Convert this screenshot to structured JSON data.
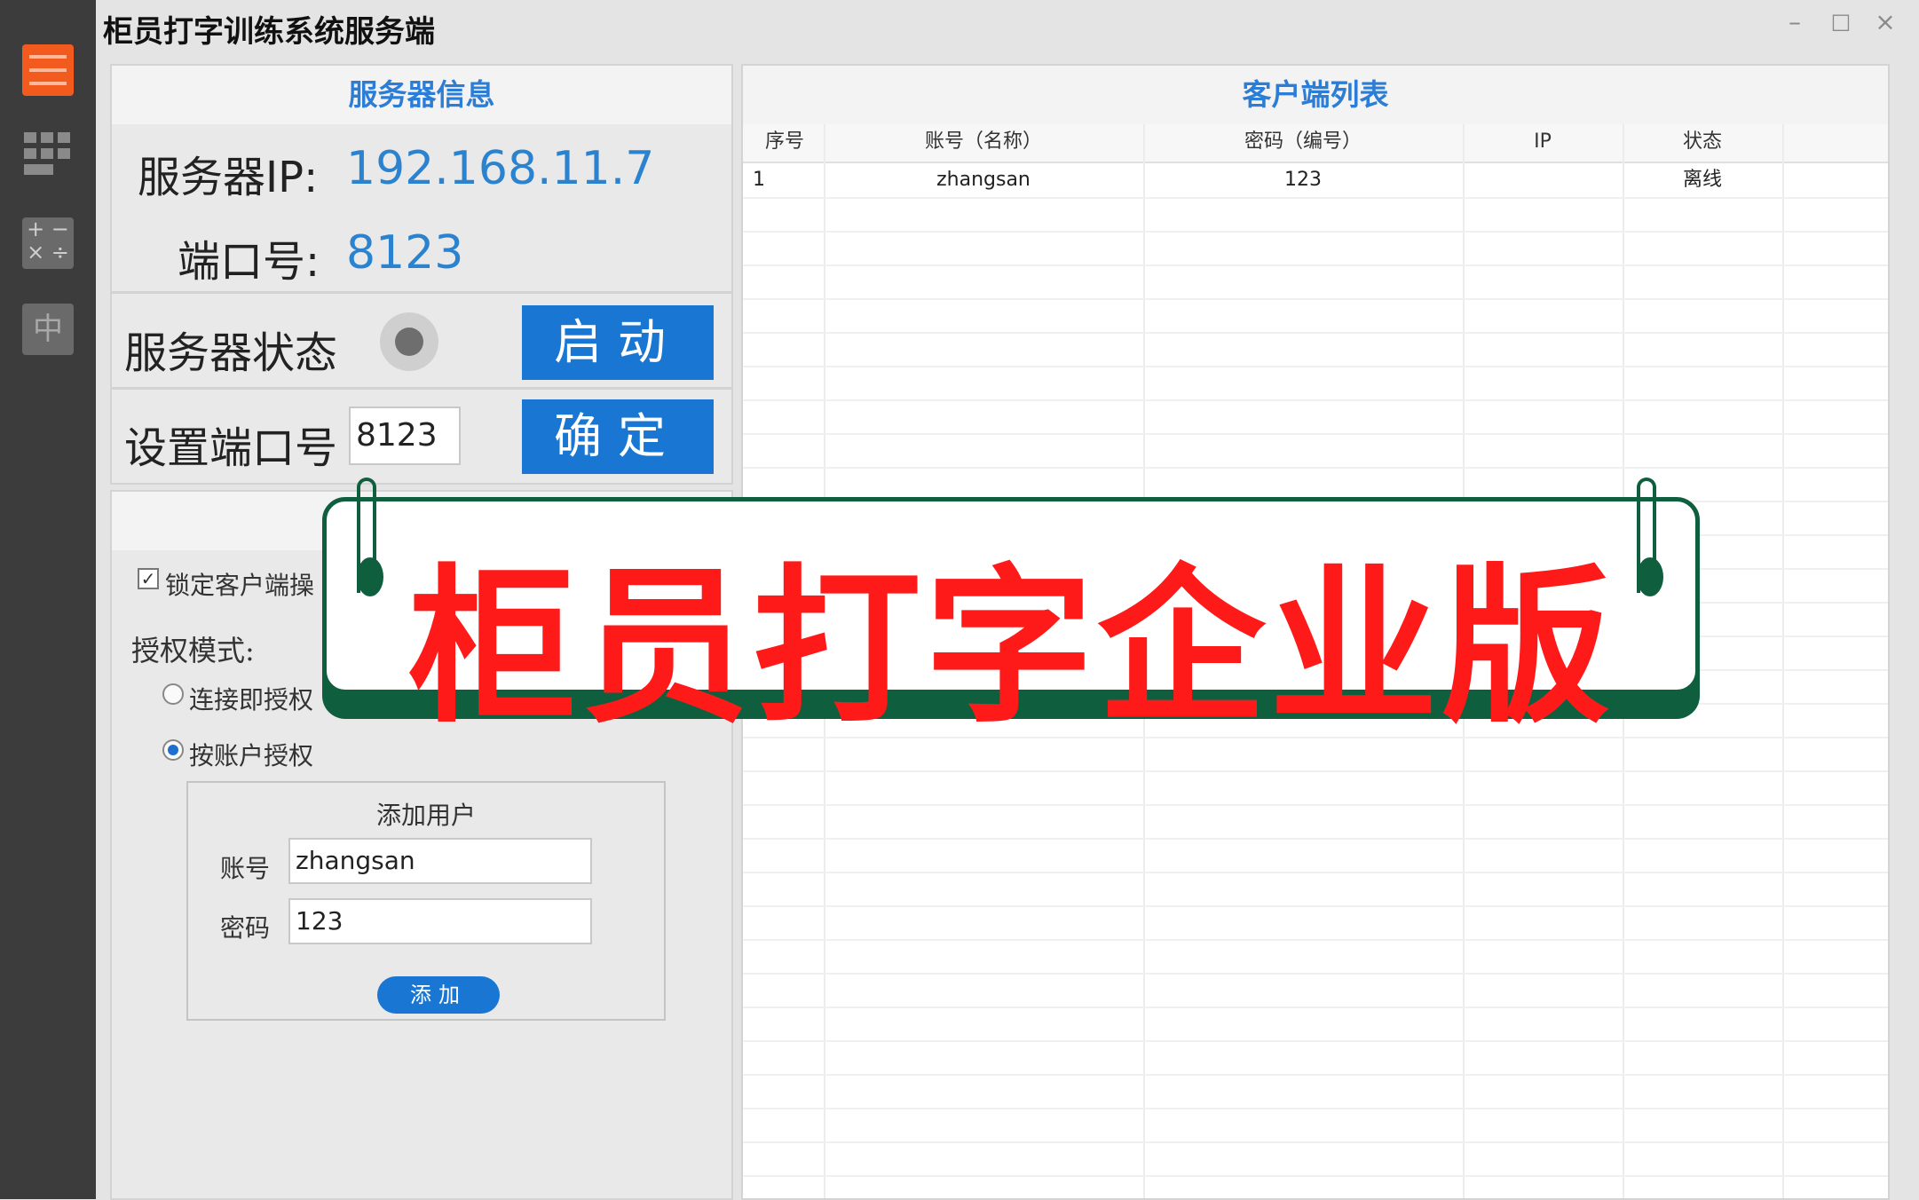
{
  "app": {
    "title": "柜员打字训练系统服务端"
  },
  "window_controls": {
    "minimize": "–",
    "maximize": "□",
    "close": "×"
  },
  "sidebar": {
    "icons": [
      "list-icon",
      "grid-icon",
      "calculator-icon",
      "chinese-input-icon"
    ],
    "cn_label": "中"
  },
  "server_info": {
    "header": "服务器信息",
    "ip_label": "服务器IP:",
    "ip_value": "192.168.11.7",
    "port_label": "端口号:",
    "port_value": "8123",
    "status_label": "服务器状态",
    "start_button": "启动",
    "set_port_label": "设置端口号",
    "set_port_value": "8123",
    "confirm_button": "确定"
  },
  "options": {
    "lock_client_label": "锁定客户端操",
    "lock_client_checked": true,
    "auth_mode_label": "授权模式:",
    "radio_connect": "连接即授权",
    "radio_account": "按账户授权",
    "selected_radio": "按账户授权"
  },
  "add_user": {
    "title": "添加用户",
    "account_label": "账号",
    "account_value": "zhangsan",
    "password_label": "密码",
    "password_value": "123",
    "add_button": "添加"
  },
  "client_list": {
    "header": "客户端列表",
    "columns": [
      "序号",
      "账号（名称）",
      "密码（编号）",
      "IP",
      "状态"
    ],
    "rows": [
      {
        "seq": "1",
        "account": "zhangsan",
        "password": "123",
        "ip": "",
        "status": "离线"
      }
    ]
  },
  "banner": {
    "text": "柜员打字企业版"
  },
  "colors": {
    "accent_blue": "#1976d2",
    "banner_red": "#ff1a1a",
    "banner_green": "#0f5f3f",
    "sidebar_orange": "#f25a1e"
  }
}
